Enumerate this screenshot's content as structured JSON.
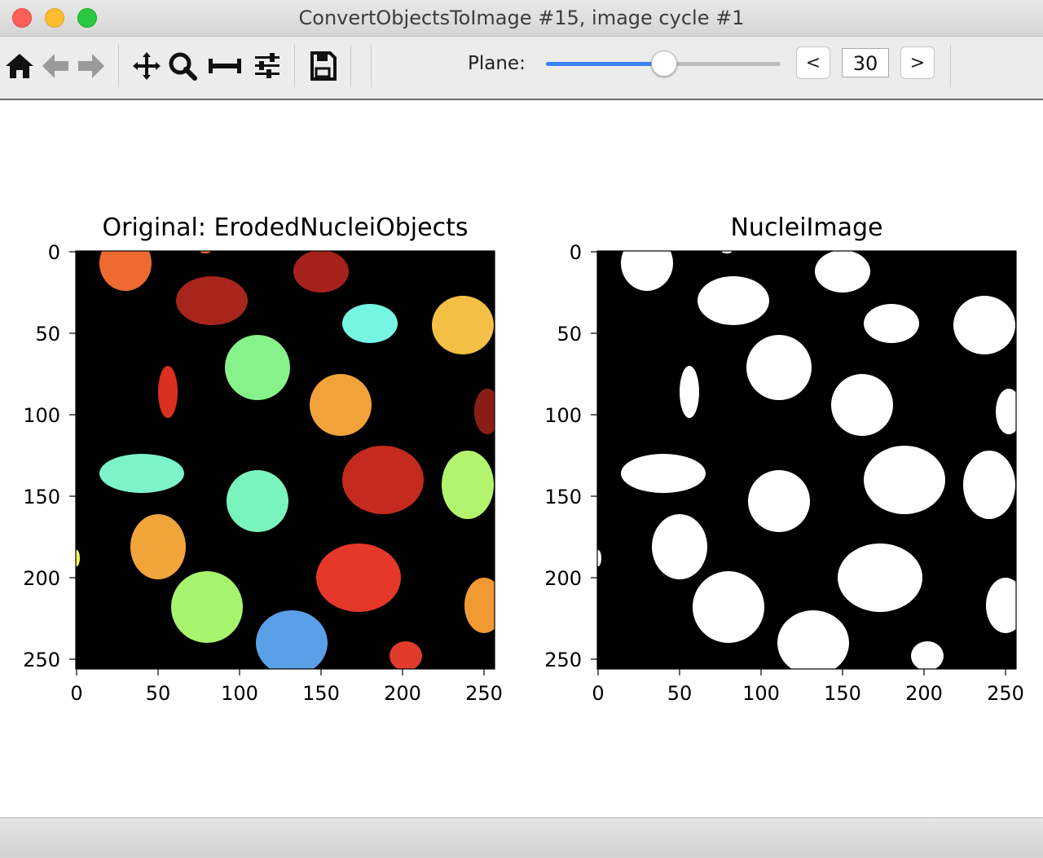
{
  "window": {
    "title": "ConvertObjectsToImage #15, image cycle #1",
    "controls": [
      "close",
      "minimize",
      "zoom"
    ]
  },
  "toolbar": {
    "tools": [
      {
        "name": "home-icon",
        "tooltip": "Reset original view"
      },
      {
        "name": "back-arrow-icon",
        "tooltip": "Back"
      },
      {
        "name": "forward-arrow-icon",
        "tooltip": "Forward"
      },
      {
        "name": "pan-icon",
        "tooltip": "Pan"
      },
      {
        "name": "zoom-icon",
        "tooltip": "Zoom"
      },
      {
        "name": "subplots-icon",
        "tooltip": "Configure subplots"
      },
      {
        "name": "customize-icon",
        "tooltip": "Edit parameters"
      },
      {
        "name": "save-icon",
        "tooltip": "Save"
      }
    ],
    "plane_label": "Plane:",
    "slider_fraction": 0.5,
    "prev_label": "<",
    "next_label": ">",
    "plane_value": "30"
  },
  "figure": {
    "left": {
      "title": "Original: ErodedNucleiObjects",
      "x_ticks": [
        "0",
        "50",
        "100",
        "150",
        "200",
        "250"
      ],
      "y_ticks": [
        "0",
        "50",
        "100",
        "150",
        "200",
        "250"
      ]
    },
    "right": {
      "title": "NucleiImage",
      "x_ticks": [
        "0",
        "50",
        "100",
        "150",
        "200",
        "250"
      ],
      "y_ticks": [
        "0",
        "50",
        "100",
        "150",
        "200",
        "250"
      ]
    }
  },
  "colors": {
    "background": "#000000",
    "mask": "#ffffff",
    "labels": [
      "#ee6a31",
      "#a8251c",
      "#a5221a",
      "#76f5e3",
      "#f4bf45",
      "#86f28a",
      "#d93020",
      "#f1a23a",
      "#8a1d14",
      "#7cf3c8",
      "#c42a1e",
      "#b3f46e",
      "#7af4bd",
      "#f1a53b",
      "#f4f554",
      "#e5372a",
      "#a7f46f",
      "#f09a32",
      "#5aa0e8",
      "#e03a2a"
    ]
  },
  "objects": [
    {
      "label": 1,
      "cx": 30,
      "cy": 7,
      "rx": 16,
      "ry": 17
    },
    {
      "label": 2,
      "cx": 83,
      "cy": 30,
      "rx": 22,
      "ry": 15
    },
    {
      "label": 3,
      "cx": 150,
      "cy": 12,
      "rx": 17,
      "ry": 13
    },
    {
      "label": 4,
      "cx": 180,
      "cy": 44,
      "rx": 17,
      "ry": 12
    },
    {
      "label": 5,
      "cx": 237,
      "cy": 45,
      "rx": 19,
      "ry": 18
    },
    {
      "label": 6,
      "cx": 111,
      "cy": 71,
      "rx": 20,
      "ry": 20
    },
    {
      "label": 7,
      "cx": 56,
      "cy": 86,
      "rx": 6,
      "ry": 16
    },
    {
      "label": 8,
      "cx": 162,
      "cy": 94,
      "rx": 19,
      "ry": 19
    },
    {
      "label": 9,
      "cx": 252,
      "cy": 98,
      "rx": 8,
      "ry": 14
    },
    {
      "label": 10,
      "cx": 40,
      "cy": 136,
      "rx": 26,
      "ry": 12
    },
    {
      "label": 11,
      "cx": 188,
      "cy": 140,
      "rx": 25,
      "ry": 21
    },
    {
      "label": 12,
      "cx": 240,
      "cy": 143,
      "rx": 16,
      "ry": 21
    },
    {
      "label": 13,
      "cx": 111,
      "cy": 153,
      "rx": 19,
      "ry": 19
    },
    {
      "label": 14,
      "cx": 50,
      "cy": 181,
      "rx": 17,
      "ry": 20
    },
    {
      "label": 15,
      "cx": 0,
      "cy": 188,
      "rx": 2,
      "ry": 5
    },
    {
      "label": 16,
      "cx": 173,
      "cy": 200,
      "rx": 26,
      "ry": 21
    },
    {
      "label": 17,
      "cx": 80,
      "cy": 218,
      "rx": 22,
      "ry": 22
    },
    {
      "label": 18,
      "cx": 250,
      "cy": 217,
      "rx": 12,
      "ry": 17
    },
    {
      "label": 19,
      "cx": 132,
      "cy": 240,
      "rx": 22,
      "ry": 20
    },
    {
      "label": 20,
      "cx": 202,
      "cy": 248,
      "rx": 10,
      "ry": 9
    },
    {
      "label": 21,
      "cx": 79,
      "cy": 0,
      "rx": 3,
      "ry": 1
    }
  ]
}
